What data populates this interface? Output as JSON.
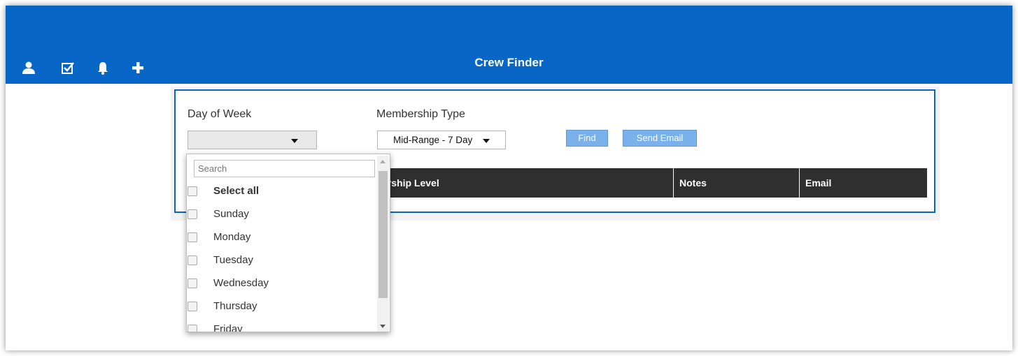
{
  "header": {
    "title": "Crew Finder",
    "icons": [
      "user-icon",
      "checkbox-icon",
      "bell-icon",
      "plus-icon"
    ],
    "background": "#0866c6"
  },
  "form": {
    "day_label": "Day of Week",
    "day_value": "",
    "membership_label": "Membership Type",
    "membership_value": "Mid-Range - 7 Day",
    "find_label": "Find",
    "send_email_label": "Send Email"
  },
  "table": {
    "columns": [
      "ership Level",
      "Notes",
      "Email"
    ]
  },
  "dropdown": {
    "search_placeholder": "Search",
    "options": [
      "Select all",
      "Sunday",
      "Monday",
      "Tuesday",
      "Wednesday",
      "Thursday",
      "Friday"
    ]
  },
  "colors": {
    "accent": "#0866c6",
    "button": "#7bb1ea",
    "table_header": "#2f2f2f"
  }
}
